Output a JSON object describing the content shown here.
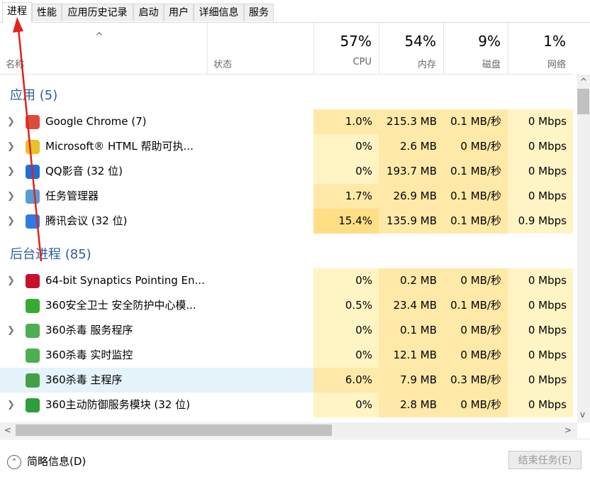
{
  "tabs": [
    "进程",
    "性能",
    "应用历史记录",
    "启动",
    "用户",
    "详细信息",
    "服务"
  ],
  "header": {
    "sort_arrow": "^",
    "name_label": "名称",
    "status_label": "状态",
    "cpu": {
      "pct": "57%",
      "label": "CPU"
    },
    "mem": {
      "pct": "54%",
      "label": "内存"
    },
    "disk": {
      "pct": "9%",
      "label": "磁盘"
    },
    "net": {
      "pct": "1%",
      "label": "网络"
    }
  },
  "groups": {
    "apps": "应用 (5)",
    "background": "后台进程 (85)"
  },
  "apps": [
    {
      "name": "Google Chrome (7)",
      "cpu": "1.0%",
      "mem": "215.3 MB",
      "disk": "0.1 MB/秒",
      "net": "0 Mbps",
      "icon": "chrome-icon",
      "color": "#dd4b39"
    },
    {
      "name": "Microsoft® HTML 帮助可执...",
      "cpu": "0%",
      "mem": "2.6 MB",
      "disk": "0 MB/秒",
      "net": "0 Mbps",
      "icon": "html-help-icon",
      "color": "#e6c229"
    },
    {
      "name": "QQ影音 (32 位)",
      "cpu": "0%",
      "mem": "193.7 MB",
      "disk": "0.1 MB/秒",
      "net": "0 Mbps",
      "icon": "qq-player-icon",
      "color": "#1e6fd9"
    },
    {
      "name": "任务管理器",
      "cpu": "1.7%",
      "mem": "26.9 MB",
      "disk": "0.1 MB/秒",
      "net": "0 Mbps",
      "icon": "task-manager-icon",
      "color": "#5b9bd5"
    },
    {
      "name": "腾讯会议 (32 位)",
      "cpu": "15.4%",
      "mem": "135.9 MB",
      "disk": "0.1 MB/秒",
      "net": "0.9 Mbps",
      "icon": "tencent-meeting-icon",
      "color": "#2d7be5"
    }
  ],
  "background": [
    {
      "name": "64-bit Synaptics Pointing En...",
      "cpu": "0%",
      "mem": "0.2 MB",
      "disk": "0 MB/秒",
      "net": "0 Mbps",
      "icon": "synaptics-icon",
      "color": "#c8102e"
    },
    {
      "name": "360安全卫士 安全防护中心模...",
      "cpu": "0.5%",
      "mem": "23.4 MB",
      "disk": "0.1 MB/秒",
      "net": "0 Mbps",
      "icon": "360-safe-icon",
      "color": "#39a935"
    },
    {
      "name": "360杀毒 服务程序",
      "cpu": "0%",
      "mem": "0.1 MB",
      "disk": "0 MB/秒",
      "net": "0 Mbps",
      "icon": "360-antivirus-service-icon",
      "color": "#4caf50"
    },
    {
      "name": "360杀毒 实时监控",
      "cpu": "0%",
      "mem": "12.1 MB",
      "disk": "0 MB/秒",
      "net": "0 Mbps",
      "icon": "360-antivirus-monitor-icon",
      "color": "#4caf50"
    },
    {
      "name": "360杀毒 主程序",
      "cpu": "6.0%",
      "mem": "7.9 MB",
      "disk": "0.3 MB/秒",
      "net": "0 Mbps",
      "icon": "360-antivirus-main-icon",
      "color": "#43a047"
    },
    {
      "name": "360主动防御服务模块 (32 位)",
      "cpu": "0%",
      "mem": "2.8 MB",
      "disk": "0 MB/秒",
      "net": "0 Mbps",
      "icon": "360-defense-icon",
      "color": "#2e9e3a"
    }
  ],
  "footer": {
    "fewer_details": "简略信息(D)",
    "end_task": "结束任务(E)"
  },
  "scroll": {
    "up": "^",
    "down": "v",
    "left": "<",
    "right": ">"
  },
  "colors": {
    "group_title": "#2c5d9e",
    "heat_low": "#fff4c4",
    "heat_mid": "#ffe9a8",
    "heat_high": "#ffde85",
    "selected_row": "#e5f3fb",
    "annotation_arrow": "#e0221d"
  }
}
